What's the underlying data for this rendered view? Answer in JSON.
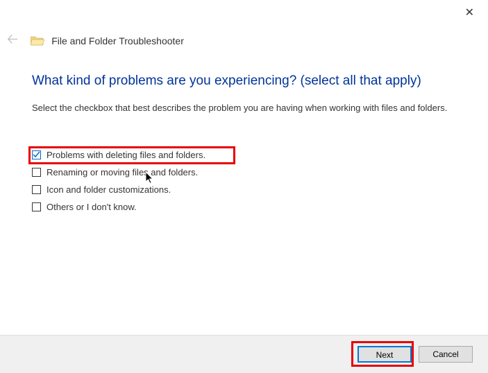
{
  "header": {
    "title": "File and Folder Troubleshooter"
  },
  "question": "What kind of problems are you experiencing? (select all that apply)",
  "instruction": "Select the checkbox that best describes the problem you are having when working with files and folders.",
  "options": [
    {
      "label": "Problems with deleting files and folders.",
      "checked": true
    },
    {
      "label": "Renaming or moving files and folders.",
      "checked": false
    },
    {
      "label": "Icon and folder customizations.",
      "checked": false
    },
    {
      "label": "Others or I don't know.",
      "checked": false
    }
  ],
  "buttons": {
    "next": "Next",
    "cancel": "Cancel"
  }
}
